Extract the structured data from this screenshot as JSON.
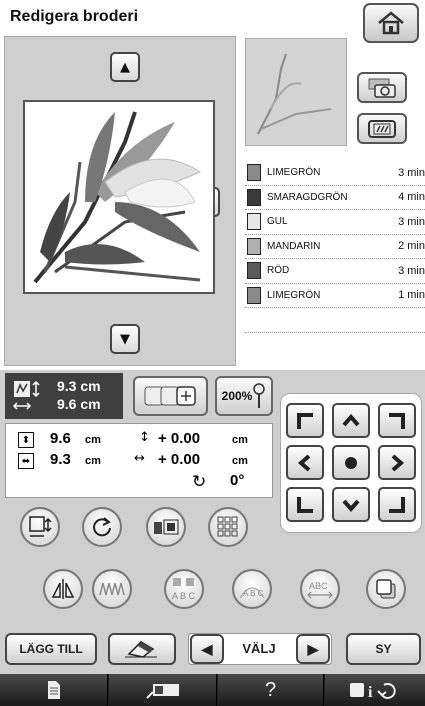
{
  "title": "Redigera broderi",
  "icons": {
    "home": "home-icon",
    "up": "arrow-up-icon",
    "down": "arrow-down-icon",
    "left": "arrow-left-icon",
    "right": "arrow-right-icon",
    "camera": "camera-icon",
    "frame": "frame-icon",
    "size_pattern": "pattern-size-icon",
    "multicolor": "multicolor-icon",
    "pin": "pin-icon",
    "resize": "resize-icon",
    "rotate": "rotate-icon",
    "thread_color": "thread-color-icon",
    "density": "density-icon",
    "mirror": "mirror-icon",
    "border": "border-icon",
    "array_text": "array-text-icon",
    "arc_text": "arc-text-icon",
    "spacing_text": "spacing-text-icon",
    "copy": "copy-icon",
    "eraser": "eraser-icon",
    "page": "page-icon",
    "machine": "machine-icon",
    "help": "help-icon",
    "settings": "settings-icon"
  },
  "threads": [
    {
      "name": "LIMEGRÖN",
      "time": "3 min",
      "color": "#8a8a8a"
    },
    {
      "name": "SMARAGDGRÖN",
      "time": "4 min",
      "color": "#3a3a3a"
    },
    {
      "name": "GUL",
      "time": "3 min",
      "color": "#e8e8e8"
    },
    {
      "name": "MANDARIN",
      "time": "2 min",
      "color": "#b0b0b0"
    },
    {
      "name": "RÖD",
      "time": "3 min",
      "color": "#5a5a5a"
    },
    {
      "name": "LIMEGRÖN",
      "time": "1 min",
      "color": "#8a8a8a"
    }
  ],
  "size": {
    "width": "9.6 cm",
    "height": "9.3 cm"
  },
  "zoom": "200%",
  "info": {
    "h_value": "9.6",
    "h_unit": "cm",
    "w_value": "9.3",
    "w_unit": "cm",
    "dy_value": "+ 0.00",
    "dy_unit": "cm",
    "dx_value": "+ 0.00",
    "dx_unit": "cm",
    "angle": "0°"
  },
  "bottom": {
    "add_label": "LÄGG TILL",
    "select_label": "VÄLJ",
    "sew_label": "SY"
  }
}
